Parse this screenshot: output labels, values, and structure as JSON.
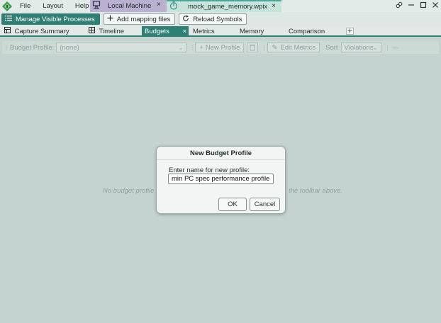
{
  "titlebar": {
    "menu": [
      "File",
      "Layout",
      "Help"
    ],
    "tabs": [
      {
        "label": "Local Machine",
        "icon": "computer-icon"
      },
      {
        "label": "mock_game_memory.wpix",
        "icon": "stopwatch-icon"
      }
    ],
    "close_glyph": "×"
  },
  "toolbar": {
    "manage_label": "Manage Visible Processes",
    "add_mapping_label": "Add mapping files",
    "reload_label": "Reload Symbols"
  },
  "view_tabs": [
    "Capture Summary",
    "Timeline",
    "Budgets",
    "Metrics",
    "Memory",
    "Comparison"
  ],
  "view_tab_active": "Budgets",
  "budget_toolbar": {
    "profile_label": "Budget Profile:",
    "profile_value": "(none)",
    "new_profile_label": "New Profile",
    "edit_metrics_label": "Edit Metrics",
    "sort_label": "Sort",
    "sort_value": "Violations"
  },
  "main": {
    "empty_left": "No budget profile",
    "empty_right": "the toolbar above."
  },
  "dialog": {
    "title": "New Budget Profile",
    "prompt": "Enter name for new profile:",
    "input_value": "min PC spec performance profile",
    "ok_label": "OK",
    "cancel_label": "Cancel"
  },
  "colors": {
    "accent": "#2e7f74",
    "local_tab": "#b9b0d2",
    "background": "#c4d3d0"
  }
}
